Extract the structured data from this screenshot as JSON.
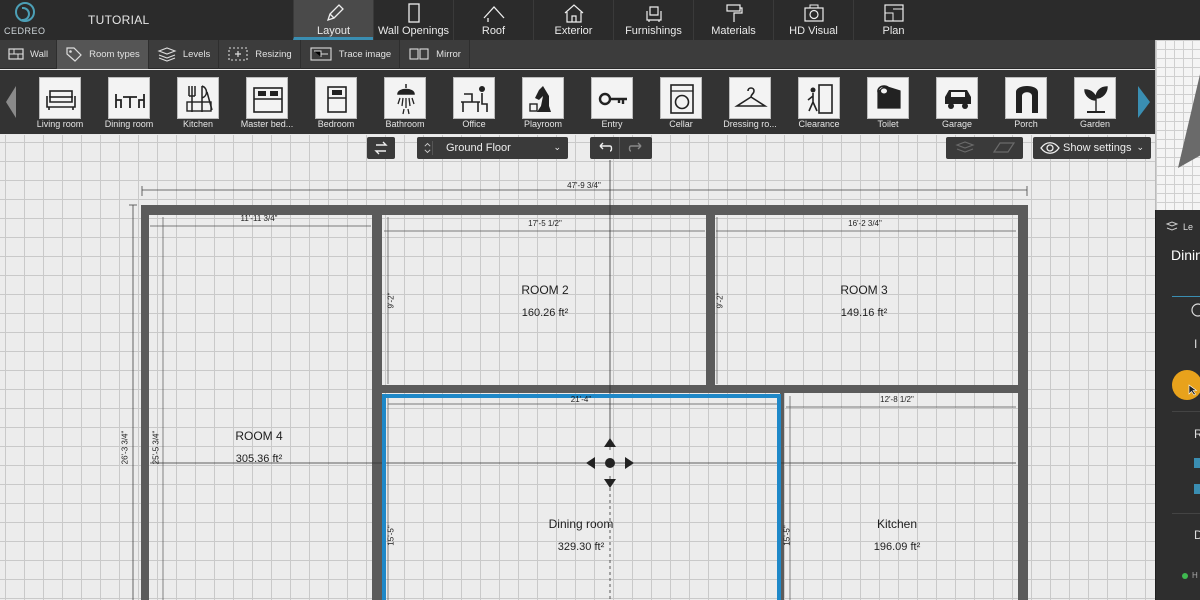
{
  "app": {
    "logo_text": "CEDREO",
    "project_title": "TUTORIAL"
  },
  "main_tabs": [
    {
      "label": "Layout",
      "icon": "pencil-icon",
      "active": true
    },
    {
      "label": "Wall Openings",
      "icon": "door-icon",
      "active": false
    },
    {
      "label": "Roof",
      "icon": "roof-icon",
      "active": false
    },
    {
      "label": "Exterior",
      "icon": "house-icon",
      "active": false
    },
    {
      "label": "Furnishings",
      "icon": "armchair-icon",
      "active": false
    },
    {
      "label": "Materials",
      "icon": "paint-roller-icon",
      "active": false
    },
    {
      "label": "HD Visual",
      "icon": "camera-icon",
      "active": false
    },
    {
      "label": "Plan",
      "icon": "blueprint-icon",
      "active": false
    }
  ],
  "sub_tabs": [
    {
      "label": "Wall",
      "icon": "wall-icon",
      "active": false
    },
    {
      "label": "Room types",
      "icon": "tag-icon",
      "active": true
    },
    {
      "label": "Levels",
      "icon": "levels-icon",
      "active": false
    },
    {
      "label": "Resizing",
      "icon": "resize-icon",
      "active": false
    },
    {
      "label": "Trace image",
      "icon": "trace-image-icon",
      "active": false
    },
    {
      "label": "Mirror",
      "icon": "mirror-icon",
      "active": false
    }
  ],
  "room_types": [
    {
      "label": "Living room",
      "icon": "sofa-icon"
    },
    {
      "label": "Dining room",
      "icon": "dining-table-icon"
    },
    {
      "label": "Kitchen",
      "icon": "kitchen-utensils-icon"
    },
    {
      "label": "Master bed...",
      "icon": "double-bed-icon"
    },
    {
      "label": "Bedroom",
      "icon": "single-bed-icon"
    },
    {
      "label": "Bathroom",
      "icon": "shower-icon"
    },
    {
      "label": "Office",
      "icon": "desk-icon"
    },
    {
      "label": "Playroom",
      "icon": "chess-knight-icon"
    },
    {
      "label": "Entry",
      "icon": "key-icon"
    },
    {
      "label": "Cellar",
      "icon": "washing-machine-icon"
    },
    {
      "label": "Dressing ro...",
      "icon": "hanger-icon"
    },
    {
      "label": "Clearance",
      "icon": "exit-door-icon"
    },
    {
      "label": "Toilet",
      "icon": "toilet-paper-icon"
    },
    {
      "label": "Garage",
      "icon": "car-icon"
    },
    {
      "label": "Porch",
      "icon": "arch-icon"
    },
    {
      "label": "Garden",
      "icon": "plant-icon"
    }
  ],
  "canvas_controls": {
    "floor_level": "Ground Floor",
    "show_settings_label": "Show settings",
    "floor_caret": "⌄",
    "settings_caret": "⌄"
  },
  "plan": {
    "overall_width": "47'-9 3/4\"",
    "overall_height": "26'-3 3/4\"",
    "rooms": [
      {
        "name": "ROOM 2",
        "area": "160.26 ft²",
        "width": "17'-5 1/2\"",
        "height": "9'-2\""
      },
      {
        "name": "ROOM 3",
        "area": "149.16 ft²",
        "width": "16'-2 3/4\"",
        "height": "9'-2\""
      },
      {
        "name": "ROOM 4",
        "area": "305.36 ft²",
        "width": "11'-11 3/4\"",
        "height": "25'-5 3/4\""
      },
      {
        "name": "Dining room",
        "area": "329.30 ft²",
        "width": "21'-4\"",
        "height": "15'-5\"",
        "selected": true
      },
      {
        "name": "Kitchen",
        "area": "196.09 ft²",
        "width": "12'-8 1/2\"",
        "height": "15'-5\""
      }
    ]
  },
  "right_panel": {
    "header_fragment": "Le",
    "room_fragment": "Dinin",
    "label_i": "I",
    "label_r": "R",
    "label_d": "D",
    "status_fragment": "H",
    "accent_color": "#e8a21c"
  },
  "colors": {
    "topbar_bg": "#2b2b2b",
    "active_tab_underline": "#3a8eb2",
    "wall": "#5b5b5b",
    "selection": "#1e88c8",
    "canvas_bg": "#ececec"
  }
}
